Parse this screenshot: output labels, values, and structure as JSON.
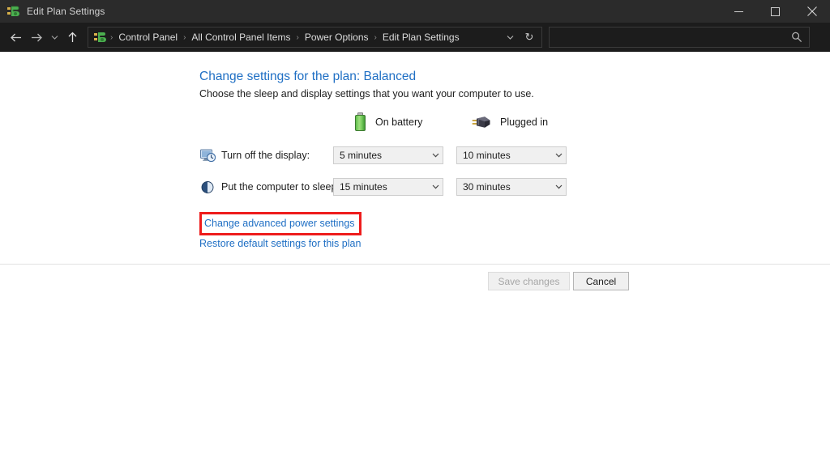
{
  "window": {
    "title": "Edit Plan Settings",
    "icon": "power-plan-icon",
    "controls": {
      "minimize": "minimize-icon",
      "maximize": "maximize-icon",
      "close": "close-icon"
    }
  },
  "nav": {
    "back": "back-arrow-icon",
    "forward": "forward-arrow-icon",
    "recent": "chevron-down-icon",
    "up": "up-arrow-icon",
    "breadcrumbs": [
      "Control Panel",
      "All Control Panel Items",
      "Power Options",
      "Edit Plan Settings"
    ],
    "separator": "›",
    "dropdown": "chevron-down-icon",
    "refresh": "↻"
  },
  "search": {
    "value": "",
    "placeholder": "",
    "icon": "search-icon"
  },
  "main": {
    "title": "Change settings for the plan: Balanced",
    "subtitle": "Choose the sleep and display settings that you want your computer to use.",
    "columns": [
      {
        "label": "On battery",
        "icon": "battery-icon"
      },
      {
        "label": "Plugged in",
        "icon": "power-plug-icon"
      }
    ],
    "settings": [
      {
        "label": "Turn off the display:",
        "icon": "display-clock-icon",
        "on_battery": "5 minutes",
        "plugged_in": "10 minutes"
      },
      {
        "label": "Put the computer to sleep:",
        "icon": "sleep-moon-icon",
        "on_battery": "15 minutes",
        "plugged_in": "30 minutes"
      }
    ],
    "links": {
      "advanced": "Change advanced power settings",
      "restore": "Restore default settings for this plan"
    },
    "highlight_color": "#ee1c1c",
    "link_color": "#1f6fc4"
  },
  "footer": {
    "save_label": "Save changes",
    "save_enabled": false,
    "cancel_label": "Cancel"
  }
}
